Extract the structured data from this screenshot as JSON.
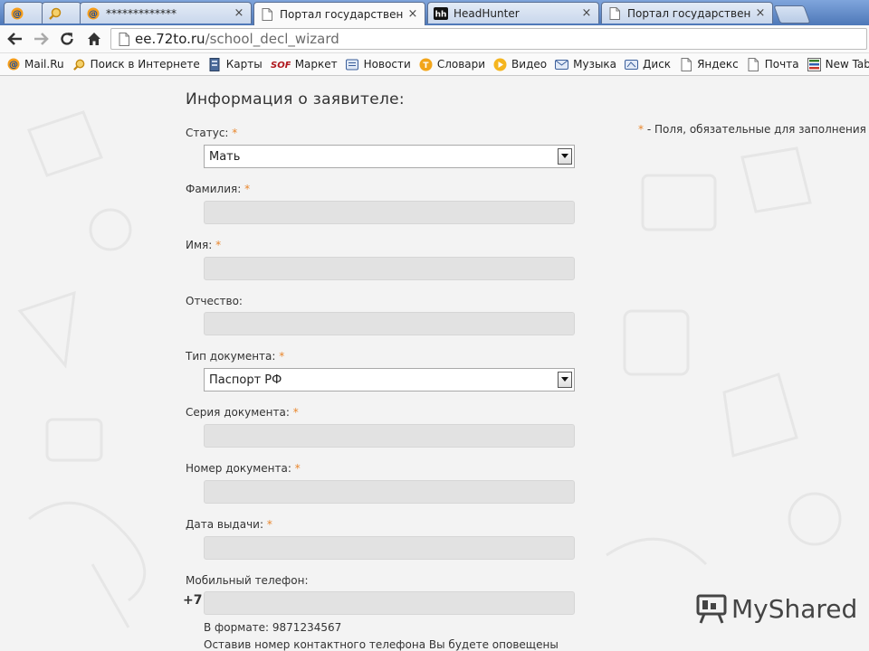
{
  "browser": {
    "tabs": [
      {
        "title": "",
        "icon": "mailru-icon",
        "active": false
      },
      {
        "title": "",
        "icon": "search-tab-icon",
        "active": false
      },
      {
        "title": "*************",
        "icon": "mailru-icon",
        "active": false
      },
      {
        "title": "Портал государственных",
        "icon": "page-icon",
        "active": true
      },
      {
        "title": "HeadHunter",
        "icon": "headhunter-icon",
        "active": false
      },
      {
        "title": "Портал государственных",
        "icon": "page-icon",
        "active": false
      }
    ],
    "close_glyph": "×",
    "url_host": "ee.72to.ru",
    "url_path": "/school_decl_wizard"
  },
  "bookmarks": [
    {
      "label": "Mail.Ru",
      "icon": "mailru-icon"
    },
    {
      "label": "Поиск в Интернете",
      "icon": "search-magnifier-icon"
    },
    {
      "label": "Карты",
      "icon": "maps-icon"
    },
    {
      "label": "Маркет",
      "icon": "soft-market-icon"
    },
    {
      "label": "Новости",
      "icon": "news-icon"
    },
    {
      "label": "Словари",
      "icon": "dictionary-icon"
    },
    {
      "label": "Видео",
      "icon": "video-icon"
    },
    {
      "label": "Музыка",
      "icon": "music-icon"
    },
    {
      "label": "Диск",
      "icon": "disk-icon"
    },
    {
      "label": "Яндекс",
      "icon": "page-icon"
    },
    {
      "label": "Почта",
      "icon": "page-icon"
    },
    {
      "label": "New Tab",
      "icon": "grid-icon"
    }
  ],
  "form": {
    "title": "Информация о заявителе:",
    "required_star": "*",
    "required_note": " - Поля, обязательные для заполнения",
    "fields": {
      "status": {
        "label": "Статус:",
        "required": true,
        "value": "Мать"
      },
      "lastname": {
        "label": "Фамилия:",
        "required": true,
        "value": ""
      },
      "firstname": {
        "label": "Имя:",
        "required": true,
        "value": ""
      },
      "patronymic": {
        "label": "Отчество:",
        "required": false,
        "value": ""
      },
      "doc_type": {
        "label": "Тип документа:",
        "required": true,
        "value": "Паспорт РФ"
      },
      "doc_series": {
        "label": "Серия документа:",
        "required": true,
        "value": ""
      },
      "doc_number": {
        "label": "Номер документа:",
        "required": true,
        "value": ""
      },
      "issue_date": {
        "label": "Дата выдачи:",
        "required": true,
        "value": ""
      },
      "mobile": {
        "label": "Мобильный телефон:",
        "required": false,
        "value": "",
        "prefix": "+7"
      }
    },
    "phone_format_hint": "В формате: 9871234567",
    "phone_notice_hint": "Оставив номер контактного телефона Вы будете оповещены"
  },
  "watermark": {
    "text": "MyShared"
  },
  "colors": {
    "accent_star": "#e9862c",
    "input_bg": "#e2e2e2",
    "tabstrip": "#5b84c4"
  }
}
